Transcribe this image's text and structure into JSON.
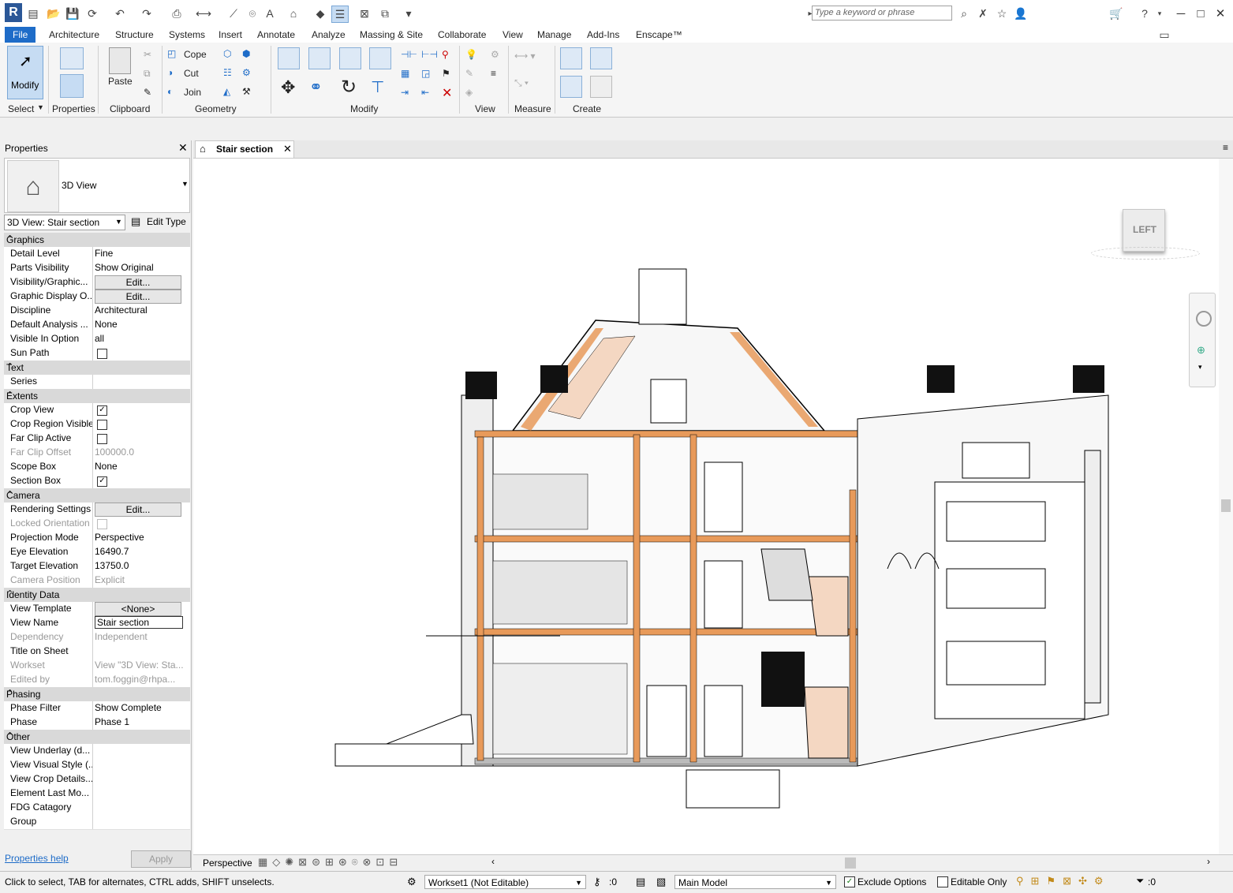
{
  "search": {
    "placeholder": "Type a keyword or phrase"
  },
  "tabs": [
    "File",
    "Architecture",
    "Structure",
    "Systems",
    "Insert",
    "Annotate",
    "Analyze",
    "Massing & Site",
    "Collaborate",
    "View",
    "Manage",
    "Add-Ins",
    "Enscape™"
  ],
  "ribbon": {
    "modify_label": "Modify",
    "select_label": "Select",
    "properties_label": "Properties",
    "paste_label": "Paste",
    "clipboard_label": "Clipboard",
    "cope_label": "Cope",
    "cut_label": "Cut",
    "join_label": "Join",
    "geometry_label": "Geometry",
    "modify_panel_label": "Modify",
    "view_label": "View",
    "measure_label": "Measure",
    "create_label": "Create"
  },
  "properties": {
    "title": "Properties",
    "type_name": "3D View",
    "instance_selector": "3D View: Stair section",
    "edit_type": "Edit Type",
    "help": "Properties help",
    "apply": "Apply",
    "groups": {
      "graphics": "Graphics",
      "text": "Text",
      "extents": "Extents",
      "camera": "Camera",
      "identity": "Identity Data",
      "phasing": "Phasing",
      "other": "Other"
    },
    "rows": {
      "detail_level": [
        "Detail Level",
        "Fine"
      ],
      "parts_visibility": [
        "Parts Visibility",
        "Show Original"
      ],
      "visibility_graphics": [
        "Visibility/Graphic...",
        "Edit..."
      ],
      "graphic_display": [
        "Graphic Display O...",
        "Edit..."
      ],
      "discipline": [
        "Discipline",
        "Architectural"
      ],
      "default_analysis": [
        "Default Analysis ...",
        "None"
      ],
      "visible_in_option": [
        "Visible In Option",
        "all"
      ],
      "sun_path": [
        "Sun Path",
        ""
      ],
      "series": [
        "Series",
        ""
      ],
      "crop_view": [
        "Crop View",
        ""
      ],
      "crop_region_visible": [
        "Crop Region Visible",
        ""
      ],
      "far_clip_active": [
        "Far Clip Active",
        ""
      ],
      "far_clip_offset": [
        "Far Clip Offset",
        "100000.0"
      ],
      "scope_box": [
        "Scope Box",
        "None"
      ],
      "section_box": [
        "Section Box",
        ""
      ],
      "rendering_settings": [
        "Rendering Settings",
        "Edit..."
      ],
      "locked_orientation": [
        "Locked Orientation",
        ""
      ],
      "projection_mode": [
        "Projection Mode",
        "Perspective"
      ],
      "eye_elevation": [
        "Eye Elevation",
        "16490.7"
      ],
      "target_elevation": [
        "Target Elevation",
        "13750.0"
      ],
      "camera_position": [
        "Camera Position",
        "Explicit"
      ],
      "view_template": [
        "View Template",
        "<None>"
      ],
      "view_name": [
        "View Name",
        "Stair section"
      ],
      "dependency": [
        "Dependency",
        "Independent"
      ],
      "title_on_sheet": [
        "Title on Sheet",
        ""
      ],
      "workset": [
        "Workset",
        "View \"3D View: Sta..."
      ],
      "edited_by": [
        "Edited by",
        "tom.foggin@rhpa..."
      ],
      "phase_filter": [
        "Phase Filter",
        "Show Complete"
      ],
      "phase": [
        "Phase",
        "Phase 1"
      ],
      "view_underlay": [
        "View Underlay (d...",
        ""
      ],
      "view_visual_style": [
        "View Visual Style (...",
        ""
      ],
      "view_crop_details": [
        "View Crop Details...",
        ""
      ],
      "element_last_mod": [
        "Element Last Mo...",
        ""
      ],
      "fdg_category": [
        "FDG Catagory",
        ""
      ],
      "group": [
        "Group",
        ""
      ]
    }
  },
  "view": {
    "tab_title": "Stair section",
    "viewcube_face": "LEFT",
    "projection": "Perspective"
  },
  "status": {
    "hint": "Click to select, TAB for alternates, CTRL adds, SHIFT unselects.",
    "workset": "Workset1 (Not Editable)",
    "count": ":0",
    "model": "Main Model",
    "exclude_options": "Exclude Options",
    "editable_only": "Editable Only",
    "filter_count": ":0"
  },
  "colors": {
    "accent": "#1e6cc8",
    "section_orange": "#e89a5a"
  }
}
